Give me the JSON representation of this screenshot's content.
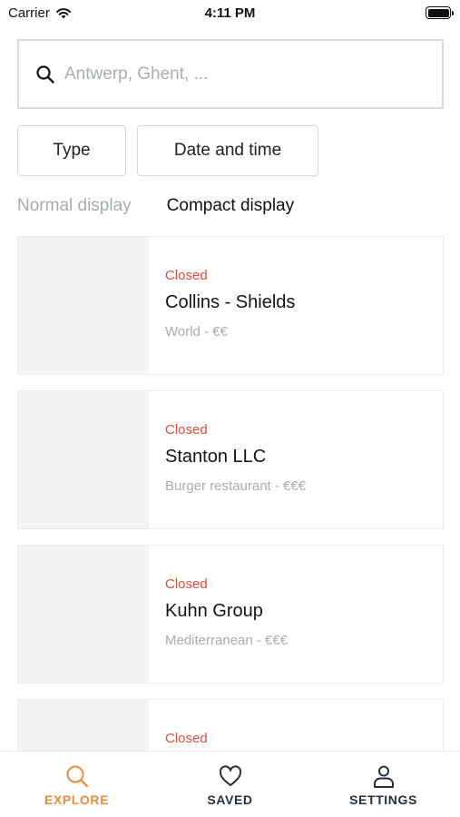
{
  "status_bar": {
    "carrier": "Carrier",
    "time": "4:11 PM"
  },
  "search": {
    "placeholder": "Antwerp, Ghent, ...",
    "value": ""
  },
  "filters": {
    "type_label": "Type",
    "date_label": "Date and time"
  },
  "display_toggle": {
    "normal_label": "Normal display",
    "compact_label": "Compact display",
    "selected": "compact"
  },
  "restaurants": [
    {
      "status": "Closed",
      "name": "Collins - Shields",
      "category": "World - €€"
    },
    {
      "status": "Closed",
      "name": "Stanton LLC",
      "category": "Burger restaurant - €€€"
    },
    {
      "status": "Closed",
      "name": "Kuhn Group",
      "category": "Mediterranean - €€€"
    },
    {
      "status": "Closed",
      "name": "",
      "category": ""
    }
  ],
  "tab_bar": {
    "explore_label": "EXPLORE",
    "saved_label": "SAVED",
    "settings_label": "SETTINGS",
    "active": "explore"
  },
  "colors": {
    "accent": "#e68d3c",
    "status_closed": "#e24a3c",
    "muted_text": "#a8adad",
    "image_placeholder": "#f3f5f4"
  }
}
